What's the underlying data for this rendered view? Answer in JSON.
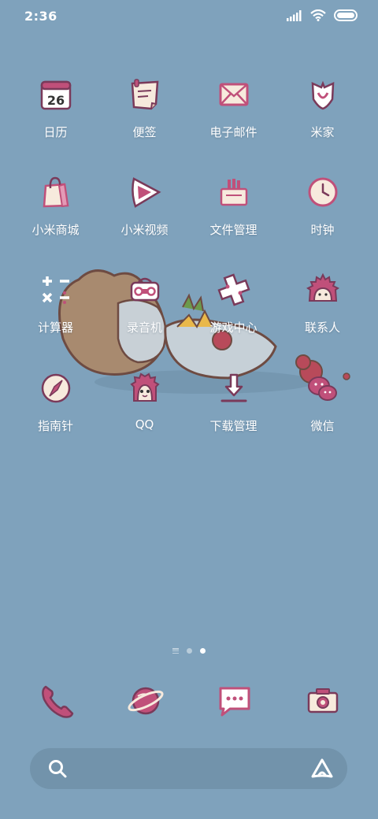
{
  "status_bar": {
    "time": "2:36",
    "icons": [
      "signal-icon",
      "wifi-icon",
      "battery-icon"
    ]
  },
  "apps": [
    {
      "label": "日历",
      "icon": "calendar-icon",
      "badge": "26"
    },
    {
      "label": "便签",
      "icon": "notes-icon"
    },
    {
      "label": "电子邮件",
      "icon": "email-icon"
    },
    {
      "label": "米家",
      "icon": "mijia-icon"
    },
    {
      "label": "小米商城",
      "icon": "shopping-bag-icon"
    },
    {
      "label": "小米视频",
      "icon": "video-play-icon"
    },
    {
      "label": "文件管理",
      "icon": "folder-icon"
    },
    {
      "label": "时钟",
      "icon": "clock-icon"
    },
    {
      "label": "计算器",
      "icon": "calculator-icon"
    },
    {
      "label": "录音机",
      "icon": "recorder-icon"
    },
    {
      "label": "游戏中心",
      "icon": "game-pad-icon"
    },
    {
      "label": "联系人",
      "icon": "hedgehog-contacts-icon"
    },
    {
      "label": "指南针",
      "icon": "compass-icon"
    },
    {
      "label": "QQ",
      "icon": "qq-icon"
    },
    {
      "label": "下载管理",
      "icon": "download-icon"
    },
    {
      "label": "微信",
      "icon": "wechat-icon"
    }
  ],
  "page_indicator": {
    "pages": 3,
    "active": 3
  },
  "dock": [
    {
      "icon": "phone-icon"
    },
    {
      "icon": "browser-planet-icon"
    },
    {
      "icon": "messages-icon"
    },
    {
      "icon": "camera-icon"
    }
  ],
  "search": {
    "icon": "search-icon",
    "assistant_icon": "assistant-icon"
  },
  "colors": {
    "background": "#7fa2bc",
    "icon_pink": "#c0507a",
    "icon_fill": "#f7eadd",
    "outline": "#7a3a5a"
  }
}
